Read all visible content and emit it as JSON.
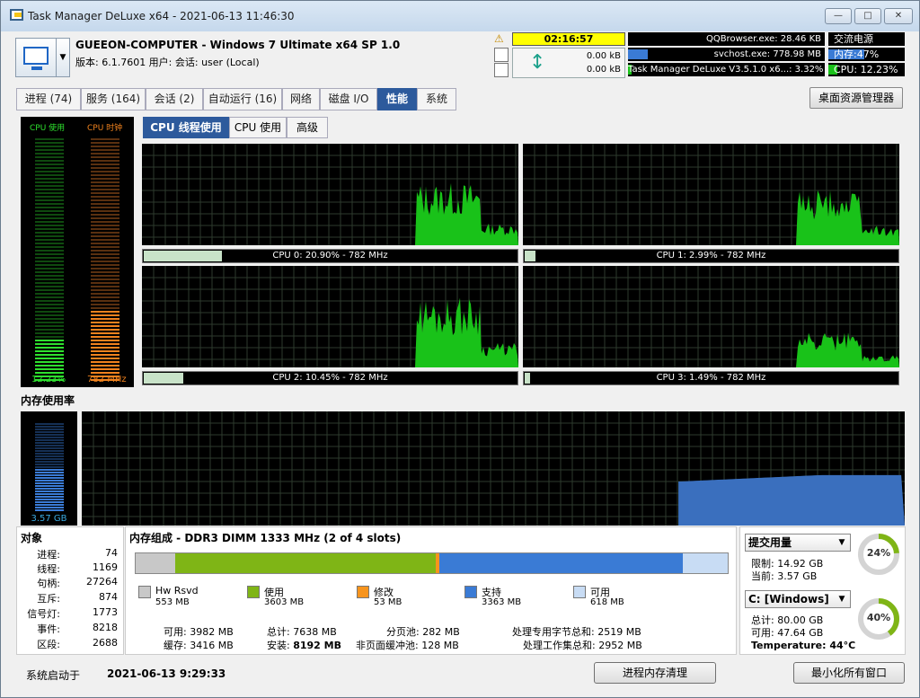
{
  "window": {
    "title": "Task Manager DeLuxe x64 - 2021-06-13 11:46:30"
  },
  "header": {
    "computer_name": "GUEEON-COMPUTER - Windows 7 Ultimate x64 SP 1.0",
    "version_line": "版本: 6.1.7601   用户: 会话: user (Local)",
    "uptime": "02:16:57",
    "net_in": "0.00 kB",
    "net_out": "0.00 kB",
    "top_processes": [
      {
        "label": "QQBrowser.exe: 28.46 KB",
        "fill": 0.0
      },
      {
        "label": "svchost.exe: 778.98 MB",
        "fill": 0.1
      },
      {
        "label": "Task Manager DeLuxe V3.5.1.0 x6...: 3.32%",
        "fill": 0.02
      }
    ],
    "side": {
      "power": "交流电源",
      "mem": "内存:47%",
      "mem_fill": 0.47,
      "cpu": "CPU: 12.23%",
      "cpu_fill": 0.12
    },
    "mem_color": "#3a7bd5",
    "cpu_color": "#19c219"
  },
  "tabs": [
    "进程 (74)",
    "服务 (164)",
    "会话 (2)",
    "自动运行 (16)",
    "网络",
    "磁盘 I/O",
    "性能",
    "系统"
  ],
  "active_tab": 6,
  "desktop_button": "桌面资源管理器",
  "cpu_panel": {
    "usage_label": "CPU 使用",
    "clock_label": "CPU 时钟",
    "usage_value": "12.23%",
    "clock_value": "782 MHz",
    "usage_level": 0.17,
    "clock_level": 0.29
  },
  "subtabs": [
    "CPU 线程使用",
    "CPU 使用",
    "高级"
  ],
  "cores": [
    {
      "label": "CPU 0: 20.90% - 782 MHz",
      "usage": 0.209
    },
    {
      "label": "CPU 1: 2.99% - 782 MHz",
      "usage": 0.0299
    },
    {
      "label": "CPU 2: 10.45% - 782 MHz",
      "usage": 0.1045
    },
    {
      "label": "CPU 3: 1.49% - 782 MHz",
      "usage": 0.0149
    }
  ],
  "memory": {
    "section_title": "内存使用率",
    "used_value": "3.57 GB",
    "level": 0.47
  },
  "objects": {
    "title": "对象",
    "rows": [
      {
        "label": "进程:",
        "value": "74"
      },
      {
        "label": "线程:",
        "value": "1169"
      },
      {
        "label": "句柄:",
        "value": "27264"
      },
      {
        "label": "互斥:",
        "value": "874"
      },
      {
        "label": "信号灯:",
        "value": "1773"
      },
      {
        "label": "事件:",
        "value": "8218"
      },
      {
        "label": "区段:",
        "value": "2688"
      }
    ]
  },
  "composition": {
    "title": "内存组成 - DDR3 DIMM 1333 MHz (2 of 4 slots)",
    "segments": [
      {
        "name": "Hw Rsvd",
        "value": "553 MB",
        "mb": 553,
        "color": "#c8c8c8"
      },
      {
        "name": "使用",
        "value": "3603 MB",
        "mb": 3603,
        "color": "#7fb516"
      },
      {
        "name": "修改",
        "value": "53 MB",
        "mb": 53,
        "color": "#f7941d"
      },
      {
        "name": "支持",
        "value": "3363 MB",
        "mb": 3363,
        "color": "#3a7bd5"
      },
      {
        "name": "可用",
        "value": "618 MB",
        "mb": 618,
        "color": "#c8dcf4"
      }
    ],
    "stats": [
      {
        "label": "可用:",
        "value": "3982 MB"
      },
      {
        "label": "缓存:",
        "value": "3416 MB"
      },
      {
        "label": "总计:",
        "value": "7638 MB"
      },
      {
        "label": "安装:",
        "value": "8192 MB"
      },
      {
        "label": "分页池:",
        "value": "282 MB"
      },
      {
        "label": "非页面缓冲池:",
        "value": "128 MB"
      },
      {
        "label": "处理专用字节总和:",
        "value": "2519 MB"
      },
      {
        "label": "处理工作集总和:",
        "value": "2952 MB"
      }
    ]
  },
  "commit": {
    "select": "提交用量",
    "limit": "限制: 14.92 GB",
    "current": "当前: 3.57 GB",
    "percent": "24%",
    "fraction": 0.24,
    "color": "#7fb516"
  },
  "drive": {
    "select": "C: [Windows]",
    "total": "总计: 80.00 GB",
    "free": "可用: 47.64 GB",
    "temp": "Temperature: 44°C",
    "percent": "40%",
    "fraction": 0.4,
    "color": "#7fb516"
  },
  "footer": {
    "boot_label": "系统启动于",
    "boot_time": "2021-06-13 9:29:33",
    "clean_button": "进程内存清理",
    "minimize_button": "最小化所有窗口"
  }
}
